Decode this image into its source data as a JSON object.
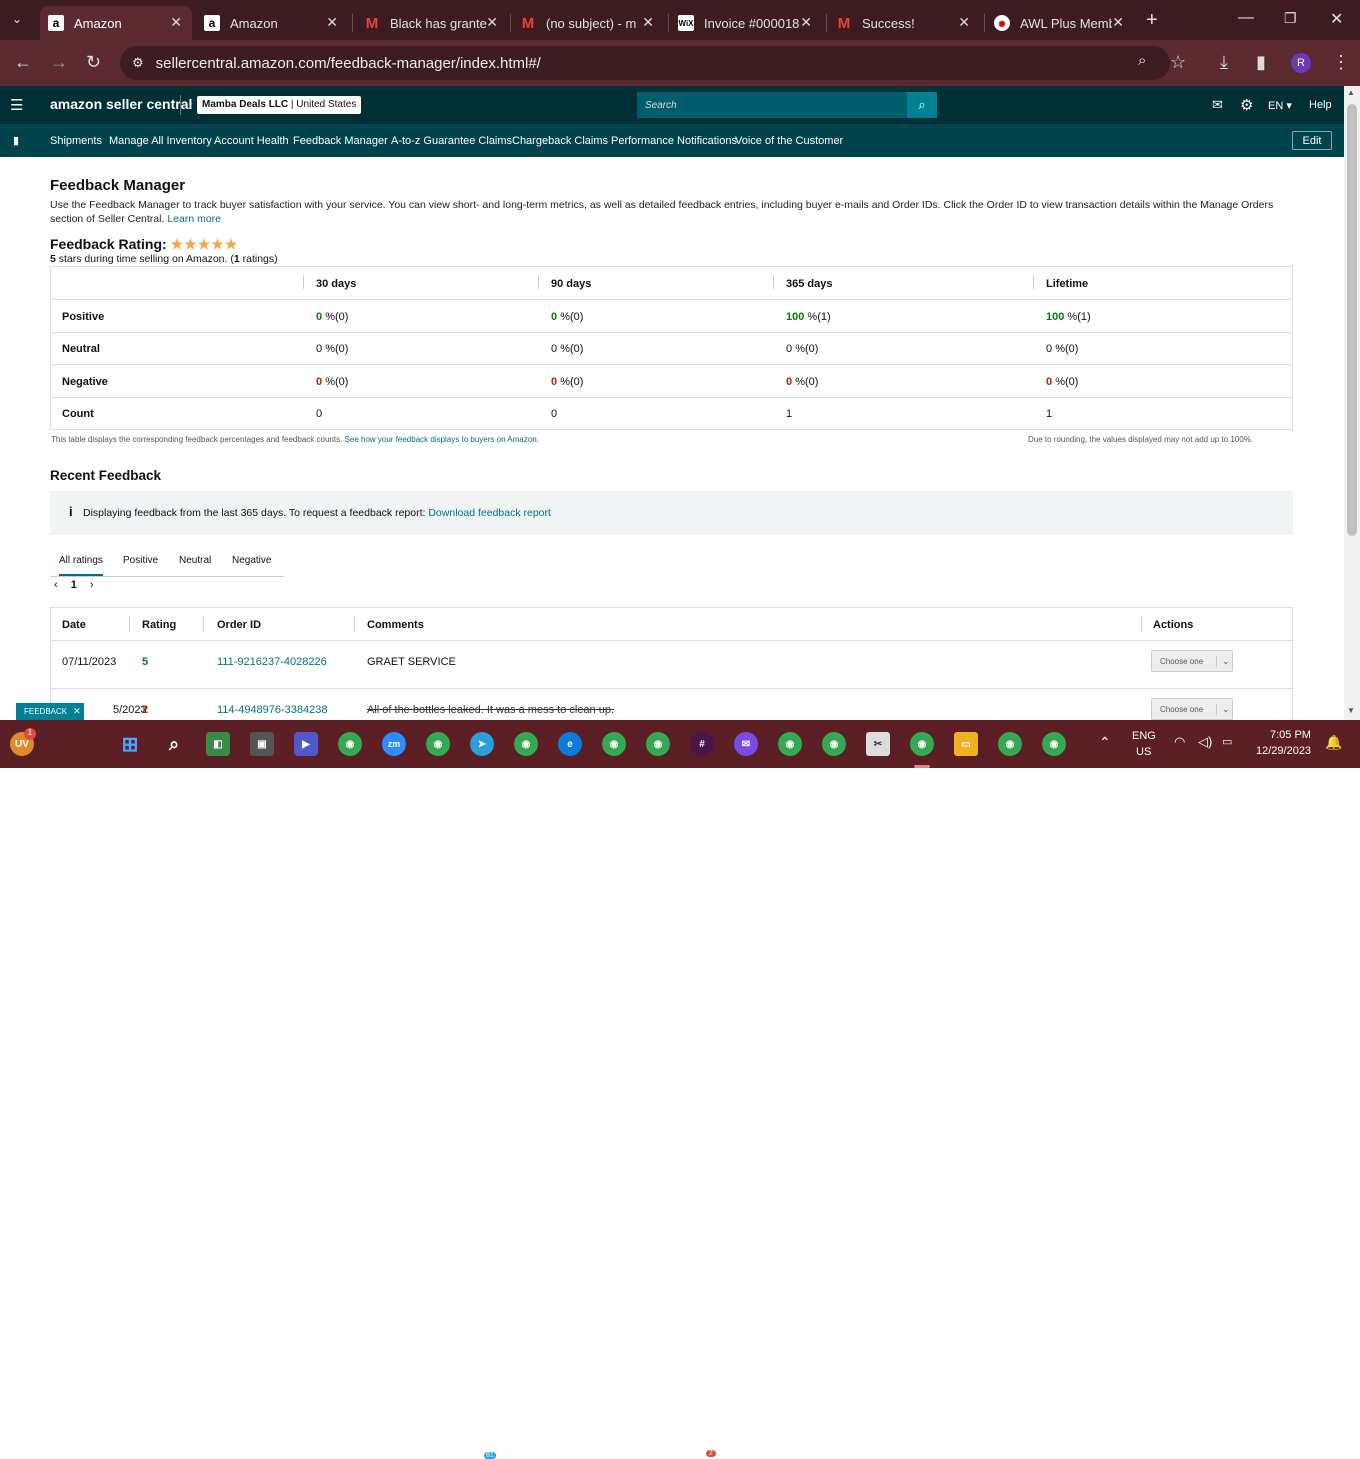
{
  "browser": {
    "tabs": [
      {
        "title": "Amazon",
        "icon": "amazon-icon"
      },
      {
        "title": "Amazon",
        "icon": "amazon-icon"
      },
      {
        "title": "Black has grante",
        "icon": "gmail-icon"
      },
      {
        "title": "(no subject) - m",
        "icon": "gmail-icon"
      },
      {
        "title": "Invoice #000018",
        "icon": "wix-icon"
      },
      {
        "title": "Success!",
        "icon": "gmail-icon"
      },
      {
        "title": "AWL Plus Memb",
        "icon": "awl-icon"
      }
    ],
    "url": "sellercentral.amazon.com/feedback-manager/index.html#/",
    "profile_initial": "R"
  },
  "header": {
    "logo": "amazon seller central",
    "account": "Mamba Deals LLC",
    "region": "United States",
    "search_placeholder": "Search",
    "language": "EN",
    "help": "Help"
  },
  "nav": {
    "items": [
      "Shipments",
      "Manage All Inventory",
      "Account Health",
      "Feedback Manager",
      "A-to-z Guarantee Claims",
      "Chargeback Claims",
      "Performance Notifications",
      "Voice of the Customer"
    ],
    "edit": "Edit"
  },
  "page": {
    "title": "Feedback Manager",
    "intro": "Use the Feedback Manager to track buyer satisfaction with your service. You can view short- and long-term metrics, as well as detailed feedback entries, including buyer e-mails and Order IDs. Click the Order ID to view transaction details within the Manage Orders section of Seller Central.",
    "learn_more": "Learn more",
    "rating_label": "Feedback Rating:",
    "stars": 5,
    "rating_stars_value": "5",
    "rating_mid": " stars during time selling on Amazon. (",
    "rating_count": "1",
    "rating_end": " ratings)",
    "star_glyphs": "★★★★★"
  },
  "summary": {
    "columns": [
      "30 days",
      "90 days",
      "365 days",
      "Lifetime"
    ],
    "rows": [
      {
        "label": "Positive",
        "values": [
          {
            "n": "0",
            "s": "%(0)"
          },
          {
            "n": "0",
            "s": "%(0)"
          },
          {
            "n": "100",
            "s": "%(1)"
          },
          {
            "n": "100",
            "s": "%(1)"
          }
        ]
      },
      {
        "label": "Neutral",
        "values": [
          {
            "n": "0",
            "s": "%(0)"
          },
          {
            "n": "0",
            "s": "%(0)"
          },
          {
            "n": "0",
            "s": "%(0)"
          },
          {
            "n": "0",
            "s": "%(0)"
          }
        ]
      },
      {
        "label": "Negative",
        "values": [
          {
            "n": "0",
            "s": "%(0)"
          },
          {
            "n": "0",
            "s": "%(0)"
          },
          {
            "n": "0",
            "s": "%(0)"
          },
          {
            "n": "0",
            "s": "%(0)"
          }
        ]
      },
      {
        "label": "Count",
        "values": [
          {
            "n": "0",
            "s": ""
          },
          {
            "n": "0",
            "s": ""
          },
          {
            "n": "1",
            "s": ""
          },
          {
            "n": "1",
            "s": ""
          }
        ]
      }
    ],
    "footnote": "This table displays the corresponding feedback percentages and feedback counts.",
    "footnote_link": "See how your feedback displays to buyers on Amazon.",
    "rounding_note": "Due to rounding, the values displayed may not add up to 100%."
  },
  "recent": {
    "title": "Recent Feedback",
    "info": "Displaying feedback from the last 365 days. To request a feedback report:",
    "info_link": "Download feedback report",
    "tabs": [
      "All ratings",
      "Positive",
      "Neutral",
      "Negative"
    ],
    "page": "1",
    "columns": [
      "Date",
      "Rating",
      "Order ID",
      "Comments",
      "Actions"
    ],
    "rows": [
      {
        "date": "07/11/2023",
        "rating": "5",
        "order": "111-9216237-4028226",
        "comment": "GRAET SERVICE",
        "action": "Choose one"
      },
      {
        "date": "5/2023",
        "rating": "2",
        "order": "114-4948976-3384238",
        "comment": "All of the bottles leaked. It was a mess to clean up.",
        "action": "Choose one"
      }
    ],
    "feedback_tag": "FEEDBACK"
  },
  "taskbar": {
    "lang": "ENG",
    "region": "US",
    "time": "7:05 PM",
    "date": "12/29/2023",
    "badges": {
      "user": "1",
      "telegram": "81",
      "slack": "2"
    }
  },
  "colors": {
    "header_bg": "#002f36",
    "nav_bg": "#00434c",
    "link": "#007185",
    "positive": "#067d06",
    "negative": "#b12704",
    "browser": "#5a2a30"
  }
}
